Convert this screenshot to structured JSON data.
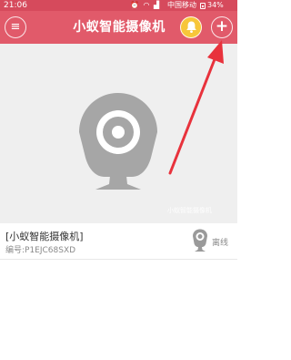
{
  "status_bar": {
    "time": "21:06",
    "carrier": "中国移动",
    "battery": "34%",
    "icons": [
      "alarm-icon",
      "wifi-icon",
      "signal-icon"
    ]
  },
  "header": {
    "title": "小蚁智能摄像机",
    "menu_icon": "≡",
    "add_icon": "+",
    "accent_color": "#e15a6a",
    "bell_color": "#f7c63a"
  },
  "preview": {
    "watermark": "小蚁智能摄像机",
    "background_color": "#efefef"
  },
  "device": {
    "name": "[小蚁智能摄像机]",
    "serial": "编号:P1EJC68SXD",
    "status": "离线"
  },
  "annotation": {
    "arrow_color": "#e8323c"
  }
}
